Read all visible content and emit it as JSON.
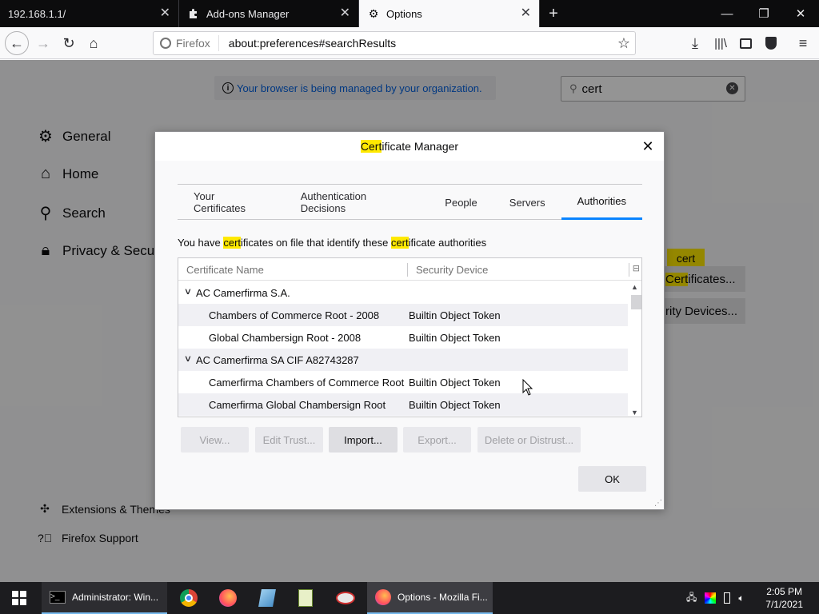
{
  "browser": {
    "tabs": [
      {
        "label": "192.168.1.1/",
        "active": false
      },
      {
        "label": "Add-ons Manager",
        "active": false
      },
      {
        "label": "Options",
        "active": true
      }
    ],
    "url_identity": "Firefox",
    "url": "about:preferences#searchResults"
  },
  "prefs": {
    "managed_notice": "Your browser is being managed by your organization.",
    "search_value": "cert",
    "categories": [
      "General",
      "Home",
      "Search",
      "Privacy & Securi"
    ],
    "footer": [
      "Extensions & Themes",
      "Firefox Support"
    ],
    "highlight_tag": "cert",
    "bg_view_certs_btn": "Certificates...",
    "bg_view_certs_btn_prefix": "Cert",
    "bg_view_certs_btn_rest": "ificates...",
    "bg_devices_btn": "rity Devices..."
  },
  "dialog": {
    "title_hl": "Cert",
    "title_rest": "ificate Manager",
    "tabs": [
      "Your Certificates",
      "Authentication Decisions",
      "People",
      "Servers",
      "Authorities"
    ],
    "active_tab": "Authorities",
    "desc_parts": [
      "You have ",
      "cert",
      "ificates on file that identify these ",
      "cert",
      "ificate authorities"
    ],
    "columns": [
      "Certificate Name",
      "Security Device"
    ],
    "rows": [
      {
        "name": "AC Camerfirma S.A.",
        "device": "",
        "group": true
      },
      {
        "name": "Chambers of Commerce Root - 2008",
        "device": "Builtin Object Token",
        "group": false
      },
      {
        "name": "Global Chambersign Root - 2008",
        "device": "Builtin Object Token",
        "group": false
      },
      {
        "name": "AC Camerfirma SA CIF A82743287",
        "device": "",
        "group": true
      },
      {
        "name": "Camerfirma Chambers of Commerce Root",
        "device": "Builtin Object Token",
        "group": false
      },
      {
        "name": "Camerfirma Global Chambersign Root",
        "device": "Builtin Object Token",
        "group": false
      }
    ],
    "buttons": {
      "view": "View...",
      "edit_trust": "Edit Trust...",
      "import": "Import...",
      "export": "Export...",
      "delete": "Delete or Distrust...",
      "ok": "OK"
    }
  },
  "taskbar": {
    "items": [
      "Administrator: Win...",
      "Options - Mozilla Fi..."
    ],
    "time": "2:05 PM",
    "date": "7/1/2021"
  },
  "colors": {
    "highlight": "#ffe900",
    "accent": "#0a84ff",
    "link": "#0060df"
  }
}
